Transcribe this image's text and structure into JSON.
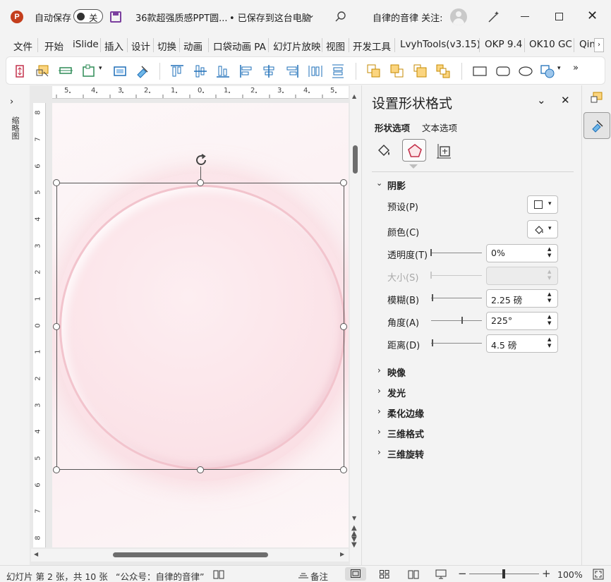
{
  "titlebar": {
    "autosave_label": "自动保存",
    "autosave_state": "关",
    "document_title": "36款超强质感PPT圆...",
    "save_status": "• 已保存到这台电脑",
    "user_label": "自律的音律 关注:"
  },
  "menu": [
    "文件",
    "开始",
    "iSlide",
    "插入",
    "设计",
    "切换",
    "动画",
    "口袋动画 PA",
    "幻灯片放映",
    "视图",
    "开发工具",
    "LvyhTools(v3.15)",
    "OKP 9.4",
    "OK10 GC",
    "Qin"
  ],
  "thumbnails_label": "缩略图",
  "ruler": {
    "h_ticks": [
      "5",
      "4",
      "3",
      "2",
      "1",
      "0",
      "1",
      "2",
      "3",
      "4",
      "5"
    ],
    "v_ticks": [
      "8",
      "7",
      "6",
      "5",
      "4",
      "3",
      "2",
      "1",
      "0",
      "1",
      "2",
      "3",
      "4",
      "5",
      "6",
      "7",
      "8"
    ]
  },
  "panel": {
    "title": "设置形状格式",
    "tab_shape": "形状选项",
    "tab_text": "文本选项",
    "shadow": {
      "title": "阴影",
      "preset_label": "预设(P)",
      "color_label": "颜色(C)",
      "transparency_label": "透明度(T)",
      "transparency_value": "0%",
      "size_label": "大小(S)",
      "size_value": "",
      "blur_label": "模糊(B)",
      "blur_value": "2.25 磅",
      "angle_label": "角度(A)",
      "angle_value": "225°",
      "distance_label": "距离(D)",
      "distance_value": "4.5 磅"
    },
    "sections": [
      "映像",
      "发光",
      "柔化边缘",
      "三维格式",
      "三维旋转"
    ]
  },
  "status": {
    "slide_info": "幻灯片 第 2 张，共 10 张",
    "author_note": "“公众号：自律的音律”",
    "notes_label": "备注",
    "zoom": "100%"
  },
  "colors": {
    "accent": "#c4314b",
    "circle_fill": "#fbe3e8",
    "ppt_icon": "#c43e1c"
  }
}
